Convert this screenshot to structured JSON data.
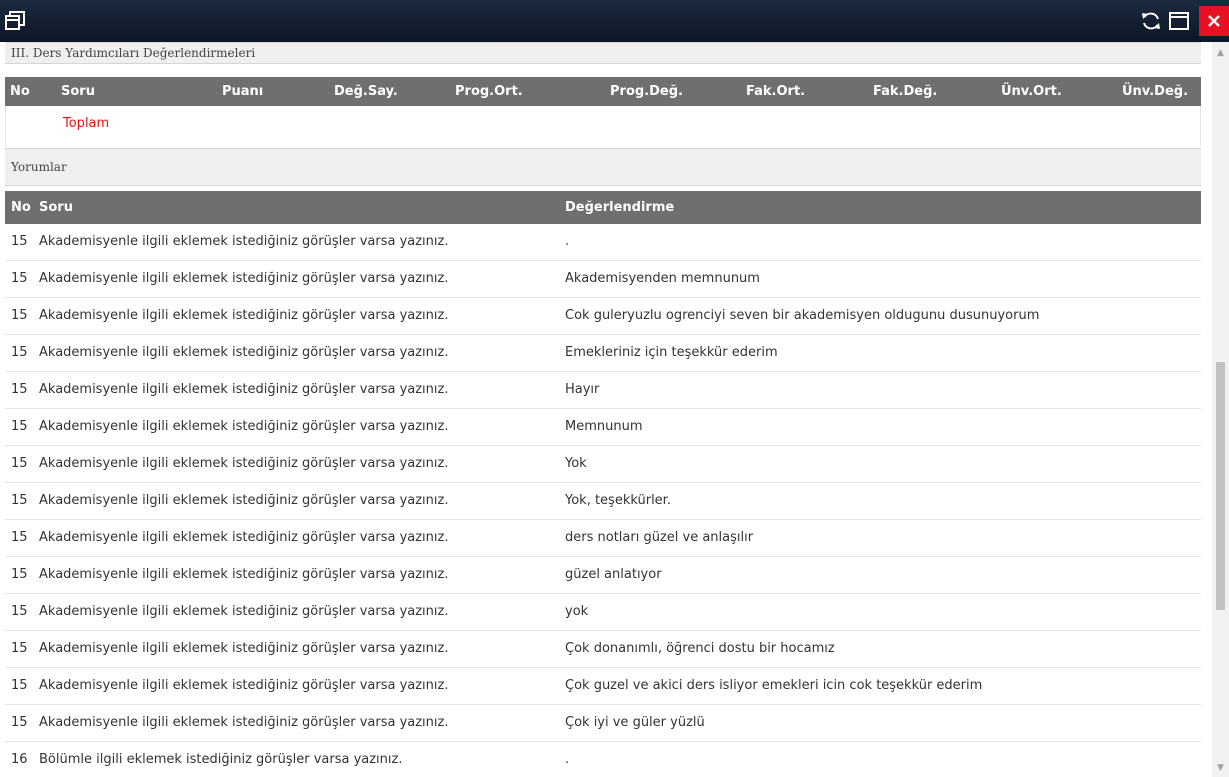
{
  "window": {
    "icons": {
      "restore": "window-restore-icon",
      "refresh": "refresh-icon",
      "maximize": "maximize-icon",
      "close": "close-icon"
    }
  },
  "section3": {
    "title": "III. Ders Yardımcıları Değerlendirmeleri",
    "headers": [
      "No",
      "Soru",
      "Puanı",
      "Değ.Say.",
      "Prog.Ort.",
      "Prog.Değ.",
      "Fak.Ort.",
      "Fak.Değ.",
      "Ünv.Ort.",
      "Ünv.Değ."
    ],
    "total_label": "Toplam"
  },
  "comments": {
    "title": "Yorumlar",
    "headers": [
      "No",
      "Soru",
      "Değerlendirme"
    ],
    "rows": [
      {
        "no": "15",
        "soru": "Akademisyenle ilgili eklemek istediğiniz görüşler varsa yazınız.",
        "deg": "."
      },
      {
        "no": "15",
        "soru": "Akademisyenle ilgili eklemek istediğiniz görüşler varsa yazınız.",
        "deg": "Akademisyenden memnunum"
      },
      {
        "no": "15",
        "soru": "Akademisyenle ilgili eklemek istediğiniz görüşler varsa yazınız.",
        "deg": "Cok guleryuzlu ogrenciyi seven bir akademisyen oldugunu dusunuyorum"
      },
      {
        "no": "15",
        "soru": "Akademisyenle ilgili eklemek istediğiniz görüşler varsa yazınız.",
        "deg": "Emekleriniz için teşekkür ederim"
      },
      {
        "no": "15",
        "soru": "Akademisyenle ilgili eklemek istediğiniz görüşler varsa yazınız.",
        "deg": "Hayır"
      },
      {
        "no": "15",
        "soru": "Akademisyenle ilgili eklemek istediğiniz görüşler varsa yazınız.",
        "deg": "Memnunum"
      },
      {
        "no": "15",
        "soru": "Akademisyenle ilgili eklemek istediğiniz görüşler varsa yazınız.",
        "deg": "Yok"
      },
      {
        "no": "15",
        "soru": "Akademisyenle ilgili eklemek istediğiniz görüşler varsa yazınız.",
        "deg": "Yok, teşekkürler."
      },
      {
        "no": "15",
        "soru": "Akademisyenle ilgili eklemek istediğiniz görüşler varsa yazınız.",
        "deg": "ders notları güzel ve anlaşılır"
      },
      {
        "no": "15",
        "soru": "Akademisyenle ilgili eklemek istediğiniz görüşler varsa yazınız.",
        "deg": "güzel anlatıyor"
      },
      {
        "no": "15",
        "soru": "Akademisyenle ilgili eklemek istediğiniz görüşler varsa yazınız.",
        "deg": "yok"
      },
      {
        "no": "15",
        "soru": "Akademisyenle ilgili eklemek istediğiniz görüşler varsa yazınız.",
        "deg": "Çok donanımlı, öğrenci dostu bir hocamız"
      },
      {
        "no": "15",
        "soru": "Akademisyenle ilgili eklemek istediğiniz görüşler varsa yazınız.",
        "deg": "Çok guzel ve akici ders isliyor emekleri icin cok teşekkür ederim"
      },
      {
        "no": "15",
        "soru": "Akademisyenle ilgili eklemek istediğiniz görüşler varsa yazınız.",
        "deg": "Çok iyi ve güler yüzlü"
      },
      {
        "no": "16",
        "soru": "Bölümle ilgili eklemek istediğiniz görüşler varsa yazınız.",
        "deg": "."
      }
    ]
  }
}
